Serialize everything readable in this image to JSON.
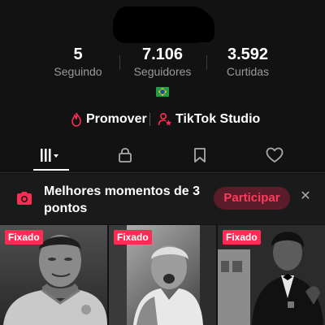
{
  "stats": [
    {
      "value": "5",
      "label": "Seguindo"
    },
    {
      "value": "7.106",
      "label": "Seguidores"
    },
    {
      "value": "3.592",
      "label": "Curtidas"
    }
  ],
  "actions": {
    "promote_label": "Promover",
    "studio_label": "TikTok Studio"
  },
  "tabs": {
    "icons": [
      "grid-icon",
      "lock-icon",
      "bookmark-icon",
      "heart-icon"
    ]
  },
  "banner": {
    "text": "Melhores momentos de 3 pontos",
    "button_label": "Participar",
    "close_label": "✕"
  },
  "videos": [
    {
      "badge": "Fixado"
    },
    {
      "badge": "Fixado"
    },
    {
      "badge": "Fixado"
    }
  ],
  "colors": {
    "accent": "#fe2c55",
    "background": "#121212",
    "banner_button_bg": "#5a1c28"
  }
}
